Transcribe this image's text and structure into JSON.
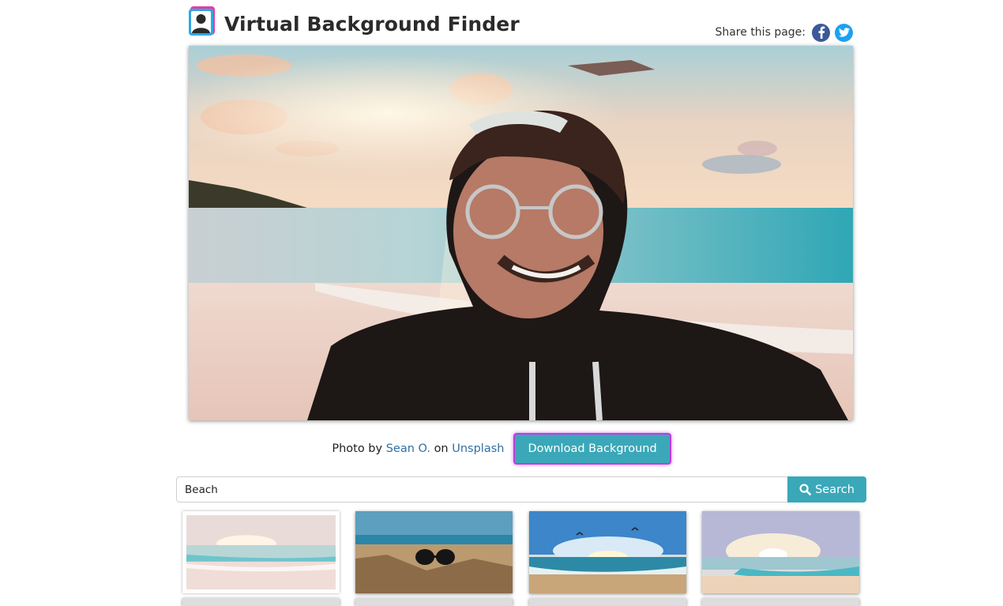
{
  "header": {
    "title": "Virtual Background Finder",
    "share_label": "Share this page:",
    "share_icons": [
      "facebook-icon",
      "twitter-icon"
    ]
  },
  "preview": {
    "alt": "Virtual background preview: beach at sunset with person overlay"
  },
  "credit": {
    "prefix": "Photo by",
    "author": "Sean O.",
    "middle": "on",
    "source": "Unsplash"
  },
  "download_label": "Download Background",
  "search": {
    "value": "Beach",
    "button_label": "Search",
    "icon": "search-icon"
  },
  "colors": {
    "accent": "#3aa8b8",
    "highlight": "#c33adf",
    "link": "#2f6fa5"
  },
  "thumbnails": [
    {
      "name": "pastel-beach-sunrise",
      "selected": true
    },
    {
      "name": "sunglasses-in-sand",
      "selected": false
    },
    {
      "name": "beach-birds-sunrise",
      "selected": false
    },
    {
      "name": "bright-sun-shore",
      "selected": false
    }
  ]
}
